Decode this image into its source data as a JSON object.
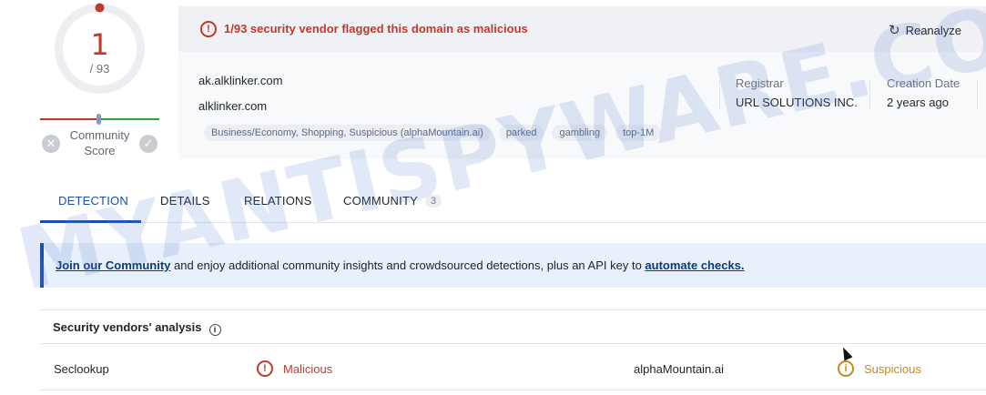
{
  "score": {
    "detections": "1",
    "total": "/ 93",
    "community_label": "Community\nScore",
    "vote_down_icon": "x-circle-icon",
    "vote_up_icon": "check-circle-icon",
    "detection_ratio": 0.0108
  },
  "alert": {
    "text": "1/93 security vendor flagged this domain as malicious",
    "reanalyze_label": "Reanalyze"
  },
  "domain": {
    "primary": "ak.alklinker.com",
    "secondary": "alklinker.com",
    "tags": [
      "Business/Economy, Shopping, Suspicious (alphaMountain.ai)",
      "parked",
      "gambling",
      "top-1M"
    ]
  },
  "meta": {
    "registrar_label": "Registrar",
    "registrar_value": "URL SOLUTIONS INC.",
    "creation_label": "Creation Date",
    "creation_value": "2 years ago"
  },
  "tabs": [
    {
      "label": "DETECTION",
      "active": true
    },
    {
      "label": "DETAILS",
      "active": false
    },
    {
      "label": "RELATIONS",
      "active": false
    },
    {
      "label": "COMMUNITY",
      "active": false,
      "badge": "3"
    }
  ],
  "banner": {
    "link1": "Join our Community",
    "middle": " and enjoy additional community insights and crowdsourced detections, plus an API key to ",
    "link2": "automate checks."
  },
  "vendors": {
    "title": "Security vendors' analysis",
    "rows": [
      {
        "vendor": "Seclookup",
        "verdict": "Malicious",
        "vendor2": "alphaMountain.ai",
        "verdict2": "Suspicious"
      }
    ]
  },
  "watermark": "MYANTISPYWARE.COM",
  "colors": {
    "malicious": "#c0392b",
    "suspicious": "#c58a1a",
    "accent": "#1a4fa8",
    "clean": "#2ea043"
  }
}
